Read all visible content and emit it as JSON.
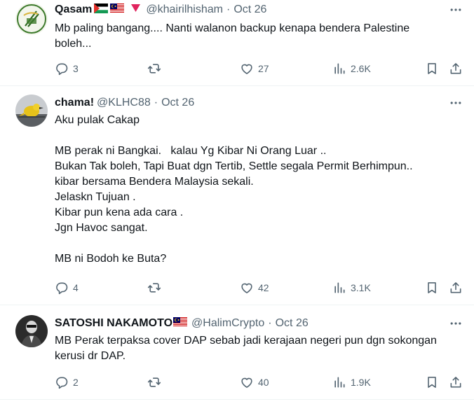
{
  "tweets": [
    {
      "name": "Qasam",
      "handle": "@khairilhisham",
      "sep": "·",
      "time": "Oct 26",
      "lines": [
        "Mb paling bangang.... Nanti walanon backup kenapa bendera Palestine",
        "boleh..."
      ],
      "replies": "3",
      "likes": "27",
      "views": "2.6K",
      "flags": [
        "palestine-flag",
        "malaysia-flag",
        "red-triangle"
      ]
    },
    {
      "name": "chama!",
      "handle": "@KLHC88",
      "sep": "·",
      "time": "Oct 26",
      "lines": [
        "Aku pulak Cakap",
        "",
        "MB perak ni Bangkai.   kalau Yg Kibar Ni Orang Luar ..",
        "Bukan Tak boleh, Tapi Buat dgn Tertib, Settle segala Permit Berhimpun..",
        "kibar bersama Bendera Malaysia sekali.",
        "Jelaskn Tujuan .",
        "Kibar pun kena ada cara .",
        "Jgn Havoc sangat.",
        "",
        "MB ni Bodoh ke Buta?"
      ],
      "replies": "4",
      "likes": "42",
      "views": "3.1K",
      "flags": []
    },
    {
      "name": "SATOSHI NAKAMOTO",
      "handle": "@HalimCrypto",
      "sep": "·",
      "time": "Oct 26",
      "lines": [
        "MB Perak terpaksa cover DAP sebab jadi kerajaan negeri pun dgn sokongan",
        "kerusi dr DAP."
      ],
      "replies": "2",
      "likes": "40",
      "views": "1.9K",
      "flags": [
        "malaysia-flag"
      ]
    }
  ],
  "colors": {
    "text": "#0f1419",
    "secondary": "#536471",
    "divider": "#eff3f4"
  },
  "icons": {
    "more": "more-dots-icon",
    "reply": "reply-icon",
    "retweet": "retweet-icon",
    "like": "heart-icon",
    "views": "views-icon",
    "bookmark": "bookmark-icon",
    "share": "share-icon"
  }
}
